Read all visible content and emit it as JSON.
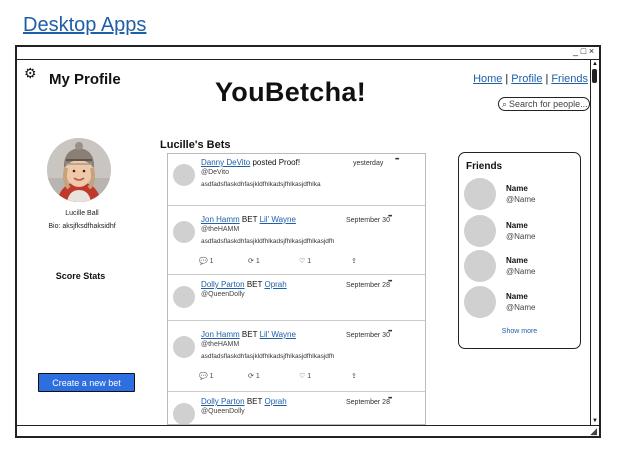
{
  "page": {
    "title": "Desktop Apps"
  },
  "window": {
    "controls": {
      "minimize": "_",
      "maximize": "□",
      "close": "×"
    },
    "resize_grip": "◢",
    "scroll_up": "▲",
    "scroll_down": "▼"
  },
  "header": {
    "settings_icon": "⚙",
    "profile_heading": "My Profile",
    "brand": "YouBetcha!",
    "nav": {
      "home": "Home",
      "profile": "Profile",
      "friends": "Friends",
      "separator": "|"
    },
    "search": {
      "placeholder": "Search for people...",
      "icon": "⌕"
    }
  },
  "profile": {
    "name": "Lucille Ball",
    "bio": "Bio: aksjfksdfhaksidhf",
    "score_stats": "Score Stats",
    "create_button": "Create a new bet"
  },
  "bets": {
    "heading": "Lucille's Bets",
    "items": [
      {
        "user": "Danny DeVito",
        "verb": "posted Proof!",
        "target": "",
        "handle": "@DeVito",
        "text": "asdfadsflaskdhfasjkldfhlkadsjfhlkasjdfhlka",
        "date": "yesterday",
        "more": "•••",
        "has_actions": false
      },
      {
        "user": "Jon Hamm",
        "verb": "BET",
        "target": "Lil' Wayne",
        "handle": "@theHAMM",
        "text": "asdfadsflaskdhfasjkldfhlkadsjfhlkasjdfhlkasjdfh",
        "date": "September 30",
        "more": "•••",
        "has_actions": true
      },
      {
        "user": "Dolly Parton",
        "verb": "BET",
        "target": "Oprah",
        "handle": "@QueenDolly",
        "text": "",
        "date": "September 28",
        "more": "•••",
        "has_actions": false
      },
      {
        "user": "Jon Hamm",
        "verb": "BET",
        "target": "Lil' Wayne",
        "handle": "@theHAMM",
        "text": "asdfadsflaskdhfasjkldfhlkadsjfhlkasjdfhlkasjdfh",
        "date": "September 30",
        "more": "•••",
        "has_actions": true
      },
      {
        "user": "Dolly Parton",
        "verb": "BET",
        "target": "Oprah",
        "handle": "@QueenDolly",
        "text": "",
        "date": "September 28",
        "more": "•••",
        "has_actions": false
      }
    ],
    "actions": {
      "comment_icon": "💬",
      "comment_count": "1",
      "repost_icon": "⟳",
      "repost_count": "1",
      "like_icon": "♡",
      "like_count": "1",
      "share_icon": "⇪"
    }
  },
  "friends": {
    "title": "Friends",
    "items": [
      {
        "name": "Name",
        "handle": "@Name"
      },
      {
        "name": "Name",
        "handle": "@Name"
      },
      {
        "name": "Name",
        "handle": "@Name"
      },
      {
        "name": "Name",
        "handle": "@Name"
      }
    ],
    "show_more": "Show more"
  }
}
